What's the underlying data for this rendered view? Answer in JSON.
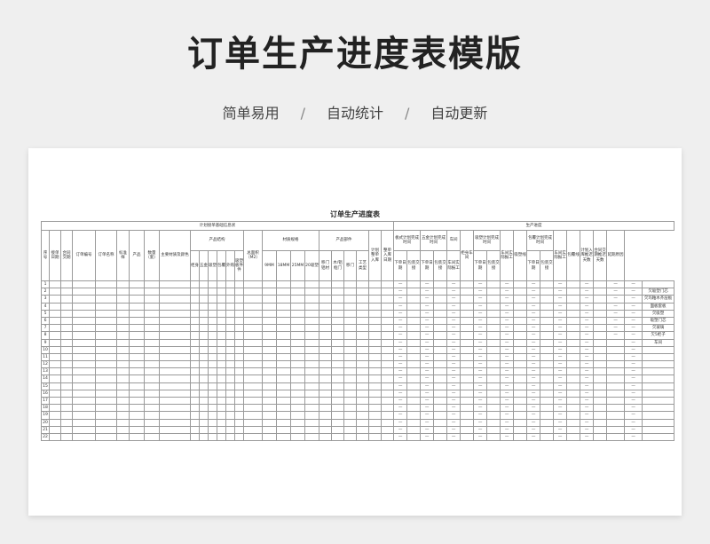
{
  "page": {
    "title": "订单生产进度表模版",
    "tags": [
      "简单易用",
      "自动统计",
      "自动更新"
    ],
    "separator": "/"
  },
  "sheet": {
    "title": "订单生产进度表",
    "groups": {
      "basic": "计划接单基础信息状",
      "production": "生产进度"
    },
    "headers": {
      "seq": "序号",
      "receive_date": "接单日期",
      "contract_date": "合同交期",
      "order_no": "订单编号",
      "order_name": "订单名称",
      "sample": "标准样",
      "product": "产品",
      "qty": "数量（套）",
      "material": "主要材质及颜色",
      "structure": "产品结构",
      "cabinet": "柜身",
      "hardware": "五金",
      "blister": "吸塑",
      "wrap": "包覆",
      "purchase": "外购",
      "board_parts": "吸塑板件件",
      "area": "总面积（M2）",
      "spec": "材质规格",
      "mm9": "9MM",
      "mm18": "18MM",
      "mm25": "25MM",
      "blister20": "20吸塑",
      "parts": "产品部件",
      "moving_door": "移门铝材",
      "wood_door": "木/铝框门",
      "move_door": "移门",
      "craft": "工艺类型",
      "plan_storage": "计划整单入库",
      "storage_date": "整单入库日期",
      "board_plan": "板式计划完成时间",
      "hardware_plan": "五金计划完成时间",
      "workshop": "车间",
      "cabinet_workshop": "柜身车间",
      "blister_plan": "吸塑计划完成时间",
      "blister_workshop": "车间实际报工",
      "blister_line": "吸塑线",
      "wrap_plan": "包覆计划完成时间",
      "wrap_workshop": "车间实际报工",
      "wrap_line": "包覆线",
      "plan_storage_days": "计划入库推迟天数",
      "contract_delay_days": "合同交期推迟天数",
      "delay_reason": "延期原因",
      "order_date": "下单日期",
      "packing": "包装交接",
      "actual_report": "车间实际报工"
    },
    "rows": [
      {
        "seq": "1",
        "reason": ""
      },
      {
        "seq": "2",
        "reason": "欠吸塑门芯"
      },
      {
        "seq": "3",
        "reason": "欠玛釉木齐层板"
      },
      {
        "seq": "4",
        "reason": "面板套板"
      },
      {
        "seq": "5",
        "reason": "欠吸塑"
      },
      {
        "seq": "6",
        "reason": "吸塑门芯"
      },
      {
        "seq": "7",
        "reason": "欠玻璃"
      },
      {
        "seq": "8",
        "reason": "欠5柜子"
      },
      {
        "seq": "9",
        "reason": "车间"
      },
      {
        "seq": "10",
        "reason": ""
      },
      {
        "seq": "11",
        "reason": ""
      },
      {
        "seq": "12",
        "reason": ""
      },
      {
        "seq": "13",
        "reason": ""
      },
      {
        "seq": "14",
        "reason": ""
      },
      {
        "seq": "15",
        "reason": ""
      },
      {
        "seq": "16",
        "reason": ""
      },
      {
        "seq": "17",
        "reason": ""
      },
      {
        "seq": "18",
        "reason": ""
      },
      {
        "seq": "19",
        "reason": ""
      },
      {
        "seq": "20",
        "reason": ""
      },
      {
        "seq": "21",
        "reason": ""
      },
      {
        "seq": "22",
        "reason": ""
      }
    ],
    "dash": "—"
  }
}
